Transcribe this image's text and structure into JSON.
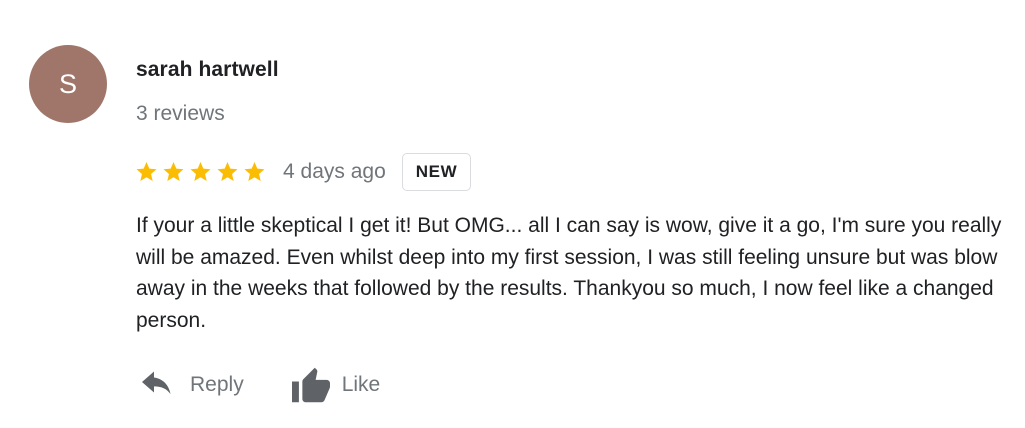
{
  "reviewer": {
    "avatar_letter": "S",
    "avatar_color": "#a0766a",
    "name": "sarah hartwell",
    "review_count": "3 reviews"
  },
  "rating": {
    "stars": 5,
    "max_stars": 5,
    "star_color": "#fbbc04",
    "date": "4 days ago",
    "badge": "NEW"
  },
  "review": {
    "text": "If your a little skeptical I get it! But OMG... all I can say is wow, give it a go, I'm sure you really will be amazed. Even whilst deep into my first session, I was still feeling unsure but was blow away in the weeks that followed by the results. Thankyou so much, I now feel like a changed person."
  },
  "actions": {
    "reply": {
      "label": "Reply",
      "icon": "reply-icon"
    },
    "like": {
      "label": "Like",
      "icon": "thumbs-up-icon"
    }
  },
  "colors": {
    "text_primary": "#202124",
    "text_secondary": "#70757a",
    "icon": "#5f6368"
  }
}
